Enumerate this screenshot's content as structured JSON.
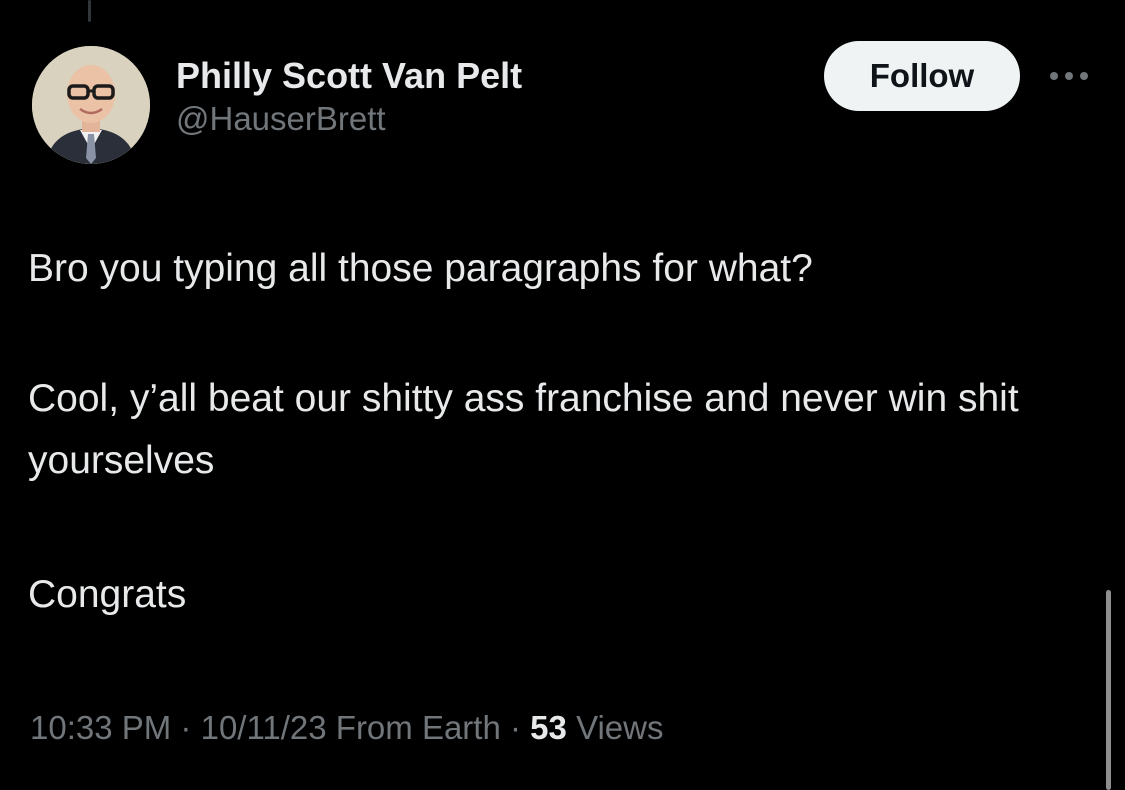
{
  "author": {
    "display_name": "Philly Scott Van Pelt",
    "handle": "@HauserBrett",
    "avatar_icon": "profile-photo"
  },
  "actions": {
    "follow_label": "Follow",
    "more_icon": "more-horizontal-icon"
  },
  "tweet": {
    "paragraphs": [
      "Bro you typing all those paragraphs for what?",
      "Cool, y’all beat our shitty ass franchise and never win shit yourselves",
      "Congrats"
    ]
  },
  "meta": {
    "time": "10:33 PM",
    "sep1": "·",
    "date": "10/11/23",
    "source": "From Earth",
    "sep2": "·",
    "views_count": "53",
    "views_label": "Views"
  },
  "colors": {
    "background": "#000000",
    "primary_text": "#e7e9ea",
    "secondary_text": "#71767b",
    "follow_bg": "#eff3f4"
  }
}
